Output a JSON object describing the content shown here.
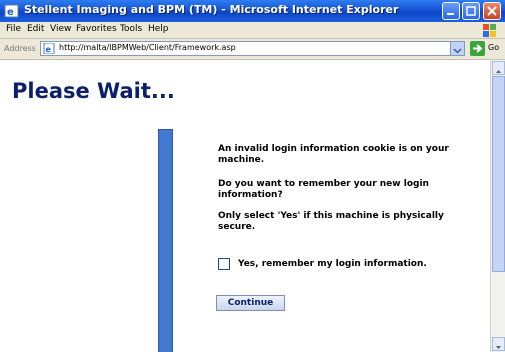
{
  "window": {
    "title": "Stellent Imaging and BPM (TM) - Microsoft Internet Explorer",
    "icon": "ie-icon",
    "controls": {
      "minimize": "minimize-icon",
      "maximize": "maximize-icon",
      "close": "close-icon"
    }
  },
  "menu": {
    "items": [
      "File",
      "Edit",
      "View",
      "Favorites",
      "Tools",
      "Help"
    ]
  },
  "address_bar": {
    "label": "Address",
    "url": "http://malta/IBPMWeb/Client/Framework.asp",
    "go_label": "Go"
  },
  "page": {
    "title": "Please Wait...",
    "message_1": "An invalid login information cookie is on your machine.",
    "message_2": "Do you want to remember your new login information?",
    "message_3": "Only select 'Yes' if this machine is physically secure.",
    "remember_label": "Yes, remember my login information.",
    "remember_checked": false,
    "continue_label": "Continue"
  },
  "colors": {
    "title_blue": "#0c1f6b",
    "bar_blue": "#4378d0",
    "titlebar_blue": "#1753d6"
  }
}
